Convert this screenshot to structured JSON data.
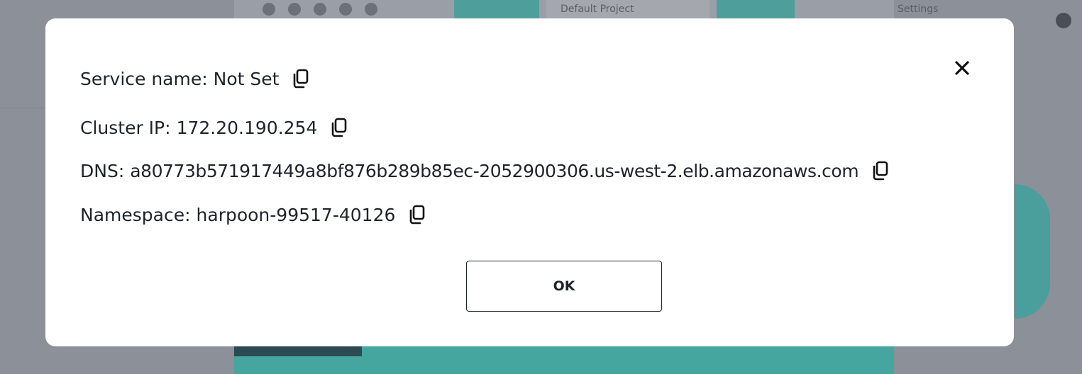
{
  "background": {
    "project_selector": "Default Project",
    "settings_label": "Settings"
  },
  "dialog": {
    "close_icon": "close-icon",
    "fields": [
      {
        "label": "Service name:",
        "value": "Not Set"
      },
      {
        "label": "Cluster IP:",
        "value": "172.20.190.254"
      },
      {
        "label": "DNS:",
        "value": "a80773b571917449a8bf876b289b85ec-2052900306.us-west-2.elb.amazonaws.com"
      },
      {
        "label": "Namespace:",
        "value": "harpoon-99517-40126"
      }
    ],
    "copy_icon": "copy-icon",
    "ok_label": "OK"
  },
  "colors": {
    "overlay": "#8c9098",
    "modal_bg": "#ffffff",
    "text": "#1f232a",
    "accent_teal": "#45a6a0"
  }
}
